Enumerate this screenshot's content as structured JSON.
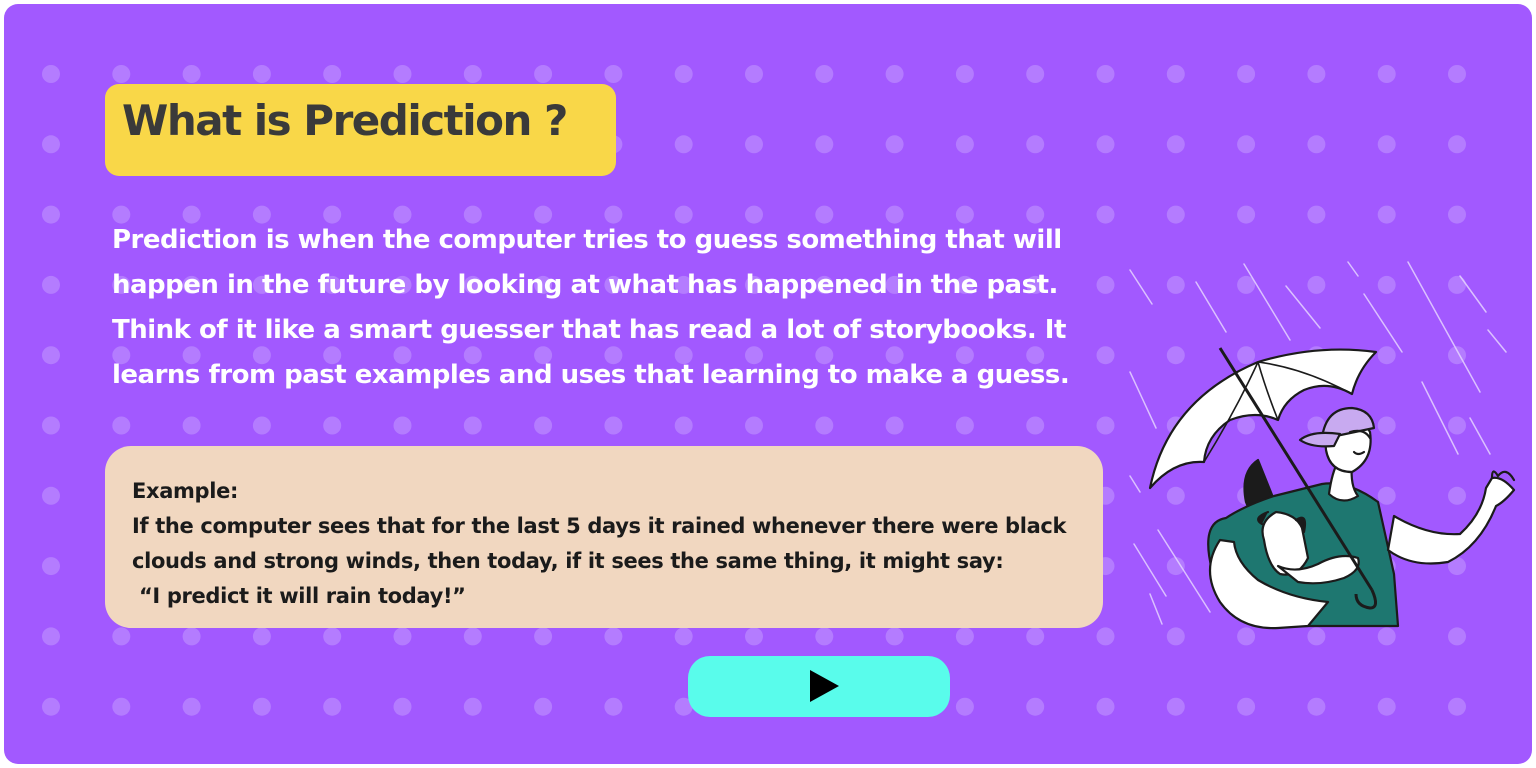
{
  "colors": {
    "background": "#a259ff",
    "dots": "#b47cff",
    "title_bg": "#f9d748",
    "example_bg": "#f1d7c0",
    "play_bg": "#59fceb",
    "teal_shirt": "#1e7770"
  },
  "title": {
    "text": "What is Prediction ?"
  },
  "intro": {
    "lines": [
      "Prediction is when the computer tries to guess something that will",
      "happen in the future by looking at what has happened in the past.",
      "Think of it like a smart guesser that has read a lot of storybooks. It",
      "learns from past examples and uses that learning to make a guess."
    ]
  },
  "example": {
    "heading": "Example:",
    "lines": [
      "If the computer sees that for the last 5 days it rained whenever there were black",
      "clouds and strong winds, then today, if it sees the same thing, it might say:",
      " “I predict it will rain today!”"
    ]
  },
  "play_button": {
    "icon": "play-icon"
  },
  "illustration": {
    "subject": "person-with-umbrella-and-dog-in-rain"
  }
}
